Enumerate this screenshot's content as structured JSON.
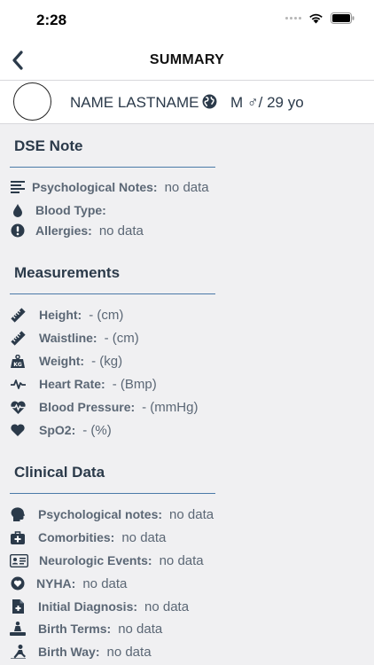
{
  "status": {
    "time": "2:28"
  },
  "nav": {
    "title": "SUMMARY"
  },
  "patient": {
    "name": "NAME LASTNAME",
    "gender_age": "M ♂/ 29 yo"
  },
  "sections": {
    "dse": {
      "title": "DSE Note",
      "rows": [
        {
          "label": "Psychological Notes:",
          "value": "no data",
          "icon": "lines-icon"
        },
        {
          "label": "Blood Type:",
          "value": "",
          "icon": "drop-icon"
        },
        {
          "label": "Allergies:",
          "value": "no data",
          "icon": "exclamation-icon"
        }
      ]
    },
    "measurements": {
      "title": "Measurements",
      "rows": [
        {
          "label": "Height:",
          "value": "- (cm)",
          "icon": "ruler-icon"
        },
        {
          "label": "Waistline:",
          "value": "- (cm)",
          "icon": "ruler-icon"
        },
        {
          "label": "Weight:",
          "value": "- (kg)",
          "icon": "weight-icon"
        },
        {
          "label": "Heart Rate:",
          "value": "- (Bmp)",
          "icon": "pulse-icon"
        },
        {
          "label": "Blood Pressure:",
          "value": "- (mmHg)",
          "icon": "heartbeat-icon"
        },
        {
          "label": "SpO2:",
          "value": "- (%)",
          "icon": "heart-icon"
        }
      ]
    },
    "clinical": {
      "title": "Clinical Data",
      "rows": [
        {
          "label": "Psychological notes:",
          "value": "no data",
          "icon": "head-icon"
        },
        {
          "label": "Comorbities:",
          "value": "no data",
          "icon": "medkit-icon"
        },
        {
          "label": "Neurologic Events:",
          "value": "no data",
          "icon": "id-card-icon"
        },
        {
          "label": "NYHA:",
          "value": "no data",
          "icon": "heart-circle-icon"
        },
        {
          "label": "Initial Diagnosis:",
          "value": "no data",
          "icon": "medical-file-icon"
        },
        {
          "label": "Birth Terms:",
          "value": "no data",
          "icon": "birth-icon"
        },
        {
          "label": "Birth Way:",
          "value": "no data",
          "icon": "baby-icon"
        }
      ]
    }
  }
}
